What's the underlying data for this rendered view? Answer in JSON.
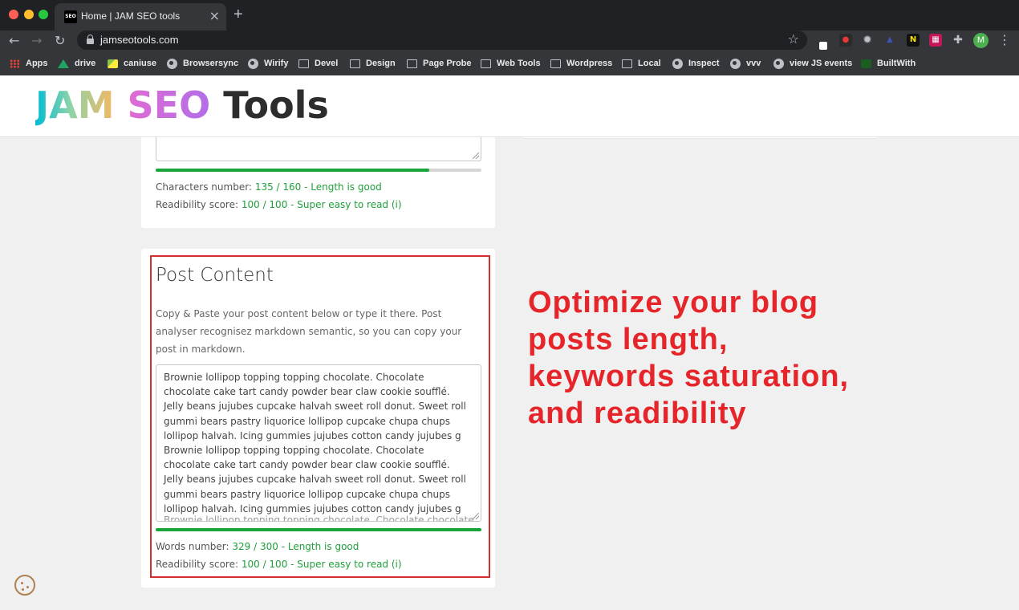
{
  "browser": {
    "tab_title": "Home | JAM SEO tools",
    "tab_favicon_text": "SEO",
    "url": "jamseotools.com",
    "profile_initial": "M",
    "bookmarks": [
      {
        "label": "Apps",
        "icon": "apps-grid-icon"
      },
      {
        "label": "drive",
        "icon": "drive-icon"
      },
      {
        "label": "caniuse",
        "icon": "image-icon"
      },
      {
        "label": "Browsersync",
        "icon": "globe-icon"
      },
      {
        "label": "Wirify",
        "icon": "globe-icon"
      },
      {
        "label": "Devel",
        "icon": "folder-icon"
      },
      {
        "label": "Design",
        "icon": "folder-icon"
      },
      {
        "label": "Page Probe",
        "icon": "folder-icon"
      },
      {
        "label": "Web Tools",
        "icon": "folder-icon"
      },
      {
        "label": "Wordpress",
        "icon": "folder-icon"
      },
      {
        "label": "Local",
        "icon": "folder-icon"
      },
      {
        "label": "Inspect",
        "icon": "globe-icon"
      },
      {
        "label": "vvv",
        "icon": "globe-icon"
      },
      {
        "label": "view JS events",
        "icon": "globe-icon"
      },
      {
        "label": "BuiltWith",
        "icon": "builtwith-icon"
      }
    ]
  },
  "site": {
    "logo": {
      "jam": "JAM",
      "seo": "SEO",
      "tools": "Tools"
    }
  },
  "description_card": {
    "characters_label": "Characters number:",
    "characters_value": "135 / 160 - Length is good",
    "characters_progress": 0.84,
    "readability_label": "Readibility score:",
    "readability_value": "100 / 100 - Super easy to read (i)"
  },
  "post_card": {
    "title": "Post Content",
    "description": "Copy & Paste your post content below or type it there. Post analyser recognisez markdown semantic, so you can copy your post in markdown.",
    "content": "Brownie lollipop topping topping chocolate. Chocolate chocolate cake tart candy powder bear claw cookie soufflé. Jelly beans jujubes cupcake halvah sweet roll donut. Sweet roll gummi bears pastry liquorice lollipop cupcake chupa chups lollipop halvah. Icing gummies jujubes cotton candy jujubes g\nBrownie lollipop topping topping chocolate. Chocolate chocolate cake tart candy powder bear claw cookie soufflé. Jelly beans jujubes cupcake halvah sweet roll donut. Sweet roll gummi bears pastry liquorice lollipop cupcake chupa chups lollipop halvah. Icing gummies jujubes cotton candy jujubes g",
    "content_cut": "Brownie lollipop topping topping chocolate. Chocolate chocolate",
    "words_label": "Words number:",
    "words_value": "329 / 300 - Length is good",
    "words_progress": 1.0,
    "readability_label": "Readibility score:",
    "readability_value": "100 / 100 - Super easy to read (i)"
  },
  "callout": "Optimize your blog posts length, keywords saturation, and readibility",
  "colors": {
    "accent_red": "#e5252a",
    "good_green": "#1f9f3a",
    "progress_green": "#1aa43a"
  }
}
